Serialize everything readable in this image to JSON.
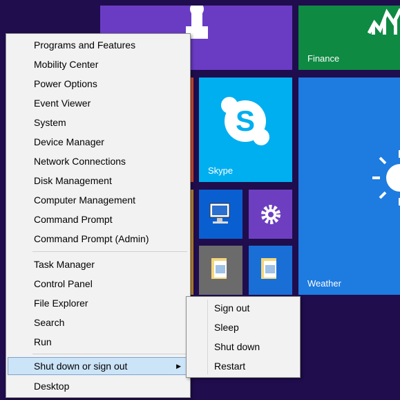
{
  "tiles": {
    "finance_label": "Finance",
    "skype_label": "Skype",
    "weather_label": "Weather"
  },
  "menu": {
    "items": [
      "Programs and Features",
      "Mobility Center",
      "Power Options",
      "Event Viewer",
      "System",
      "Device Manager",
      "Network Connections",
      "Disk Management",
      "Computer Management",
      "Command Prompt",
      "Command Prompt (Admin)",
      "Task Manager",
      "Control Panel",
      "File Explorer",
      "Search",
      "Run",
      "Shut down or sign out",
      "Desktop"
    ]
  },
  "submenu": {
    "items": [
      "Sign out",
      "Sleep",
      "Shut down",
      "Restart"
    ]
  },
  "icons": {
    "submenu_arrow": "chevron-right-icon"
  }
}
